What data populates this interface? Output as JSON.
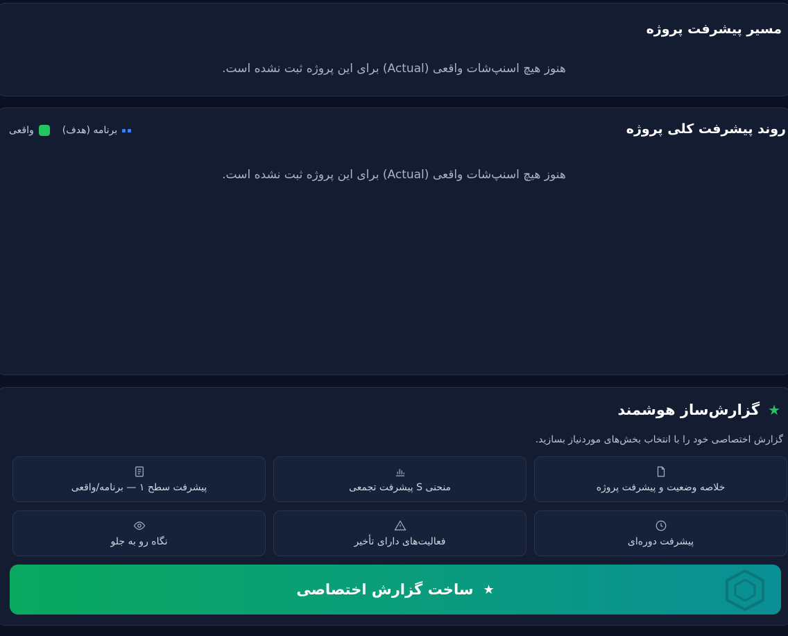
{
  "path_card": {
    "title": "مسیر پیشرفت پروژه",
    "empty_message": "هنوز هیچ اسنپ‌شات واقعی (Actual) برای این پروژه ثبت نشده است."
  },
  "trend_card": {
    "title": "روند پیشرفت کلی پروژه",
    "legend": {
      "planned_label": "برنامه (هدف)",
      "actual_label": "واقعی",
      "planned_color": "#3b82f6",
      "actual_color": "#22c55e"
    },
    "empty_message": "هنوز هیچ اسنپ‌شات واقعی (Actual) برای این پروژه ثبت نشده است."
  },
  "report_builder": {
    "title": "گزارش‌ساز هوشمند",
    "subtitle": "گزارش اختصاصی خود را با انتخاب بخش‌های موردنیاز بسازید.",
    "options": [
      {
        "label": "خلاصه وضعیت و پیشرفت پروژه",
        "icon": "document-icon"
      },
      {
        "label": "منحنی S پیشرفت تجمعی",
        "icon": "bar-chart-icon"
      },
      {
        "label": "پیشرفت سطح ۱ — برنامه/واقعی",
        "icon": "list-document-icon"
      },
      {
        "label": "پیشرفت دوره‌ای",
        "icon": "clock-icon"
      },
      {
        "label": "فعالیت‌های دارای تأخیر",
        "icon": "warning-icon"
      },
      {
        "label": "نگاه رو به جلو",
        "icon": "eye-icon"
      }
    ],
    "generate_button_label": "ساخت گزارش اختصاصی",
    "accent_color": "#22c55e"
  }
}
